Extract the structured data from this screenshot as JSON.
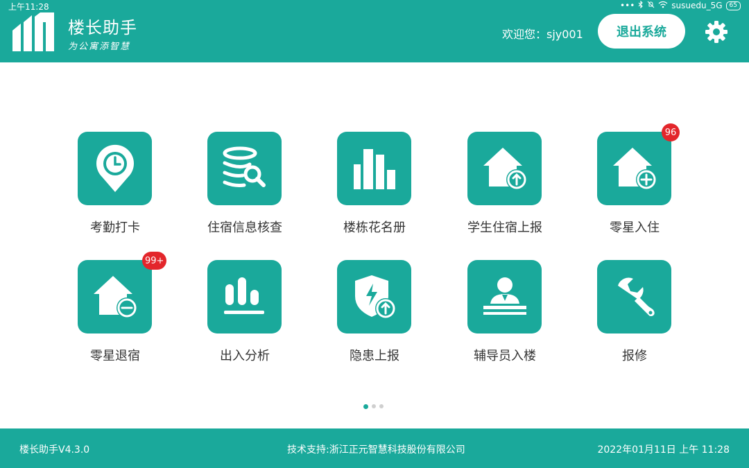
{
  "status": {
    "time": "上午11:28",
    "wifi_name": "susuedu_5G",
    "battery": "65",
    "dots": "•••"
  },
  "header": {
    "title": "楼长助手",
    "slogan": "为公寓添智慧",
    "welcome": "欢迎您：sjy001",
    "logout_label": "退出系统"
  },
  "tiles": [
    {
      "label": "考勤打卡",
      "icon": "clock-pin-icon"
    },
    {
      "label": "住宿信息核查",
      "icon": "database-search-icon"
    },
    {
      "label": "楼栋花名册",
      "icon": "bar-chart-icon"
    },
    {
      "label": "学生住宿上报",
      "icon": "house-upload-icon"
    },
    {
      "label": "零星入住",
      "icon": "house-plus-icon",
      "badge": "96"
    },
    {
      "label": "零星退宿",
      "icon": "house-minus-icon",
      "badge": "99+"
    },
    {
      "label": "出入分析",
      "icon": "stats-icon"
    },
    {
      "label": "隐患上报",
      "icon": "shield-upload-icon"
    },
    {
      "label": "辅导员入楼",
      "icon": "counselor-icon"
    },
    {
      "label": "报修",
      "icon": "wrench-icon"
    }
  ],
  "pager": {
    "pages": 3,
    "active": 0
  },
  "footer": {
    "version": "楼长助手V4.3.0",
    "support": "技术支持:浙江正元智慧科技股份有限公司",
    "datetime": "2022年01月11日 上午 11:28"
  },
  "colors": {
    "accent": "#1aa99b",
    "badge": "#e3262b"
  }
}
